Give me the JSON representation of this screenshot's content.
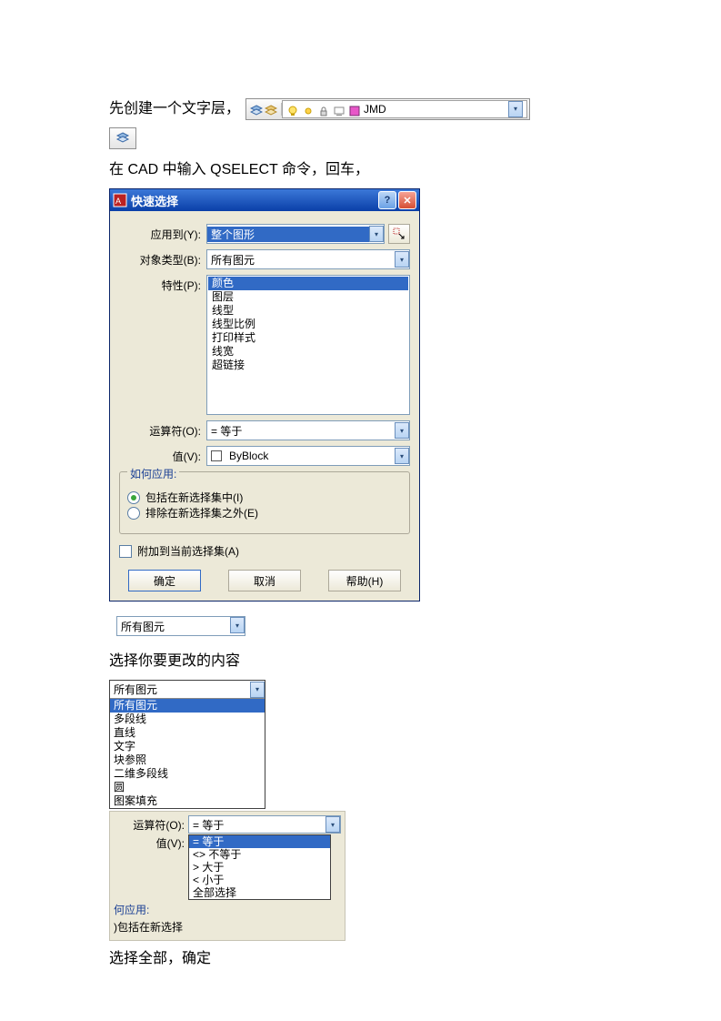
{
  "para1_prefix": "先创建一个文字层，",
  "layer_toolbar": {
    "text": "JMD"
  },
  "para2": "在 CAD 中输入 QSELECT 命令，回车，",
  "dialog": {
    "title": "快速选择",
    "apply_to_label": "应用到(Y):",
    "apply_to_value": "整个图形",
    "obj_type_label": "对象类型(B):",
    "obj_type_value": "所有图元",
    "property_label": "特性(P):",
    "properties": [
      "颜色",
      "图层",
      "线型",
      "线型比例",
      "打印样式",
      "线宽",
      "超链接"
    ],
    "operator_label": "运算符(O):",
    "operator_value": "= 等于",
    "value_label": "值(V):",
    "value_value": "ByBlock",
    "howapply_legend": "如何应用:",
    "radio_include": "包括在新选择集中(I)",
    "radio_exclude": "排除在新选择集之外(E)",
    "check_append": "附加到当前选择集(A)",
    "btn_ok": "确定",
    "btn_cancel": "取消",
    "btn_help": "帮助(H)"
  },
  "mini_combo_value": "所有图元",
  "para3": "选择你要更改的内容",
  "objtype_dd": {
    "head": "所有图元",
    "items": [
      "所有图元",
      "多段线",
      "直线",
      "文字",
      "块参照",
      "二维多段线",
      "圆",
      "图案填充"
    ]
  },
  "panel2": {
    "operator_label": "运算符(O):",
    "operator_head": "= 等于",
    "value_label": "值(V):",
    "operators": [
      "= 等于",
      "<> 不等于",
      "> 大于",
      "< 小于",
      "全部选择"
    ],
    "howapply": "何应用:",
    "include_short": "包括在新选择"
  },
  "para4": "选择全部，确定"
}
